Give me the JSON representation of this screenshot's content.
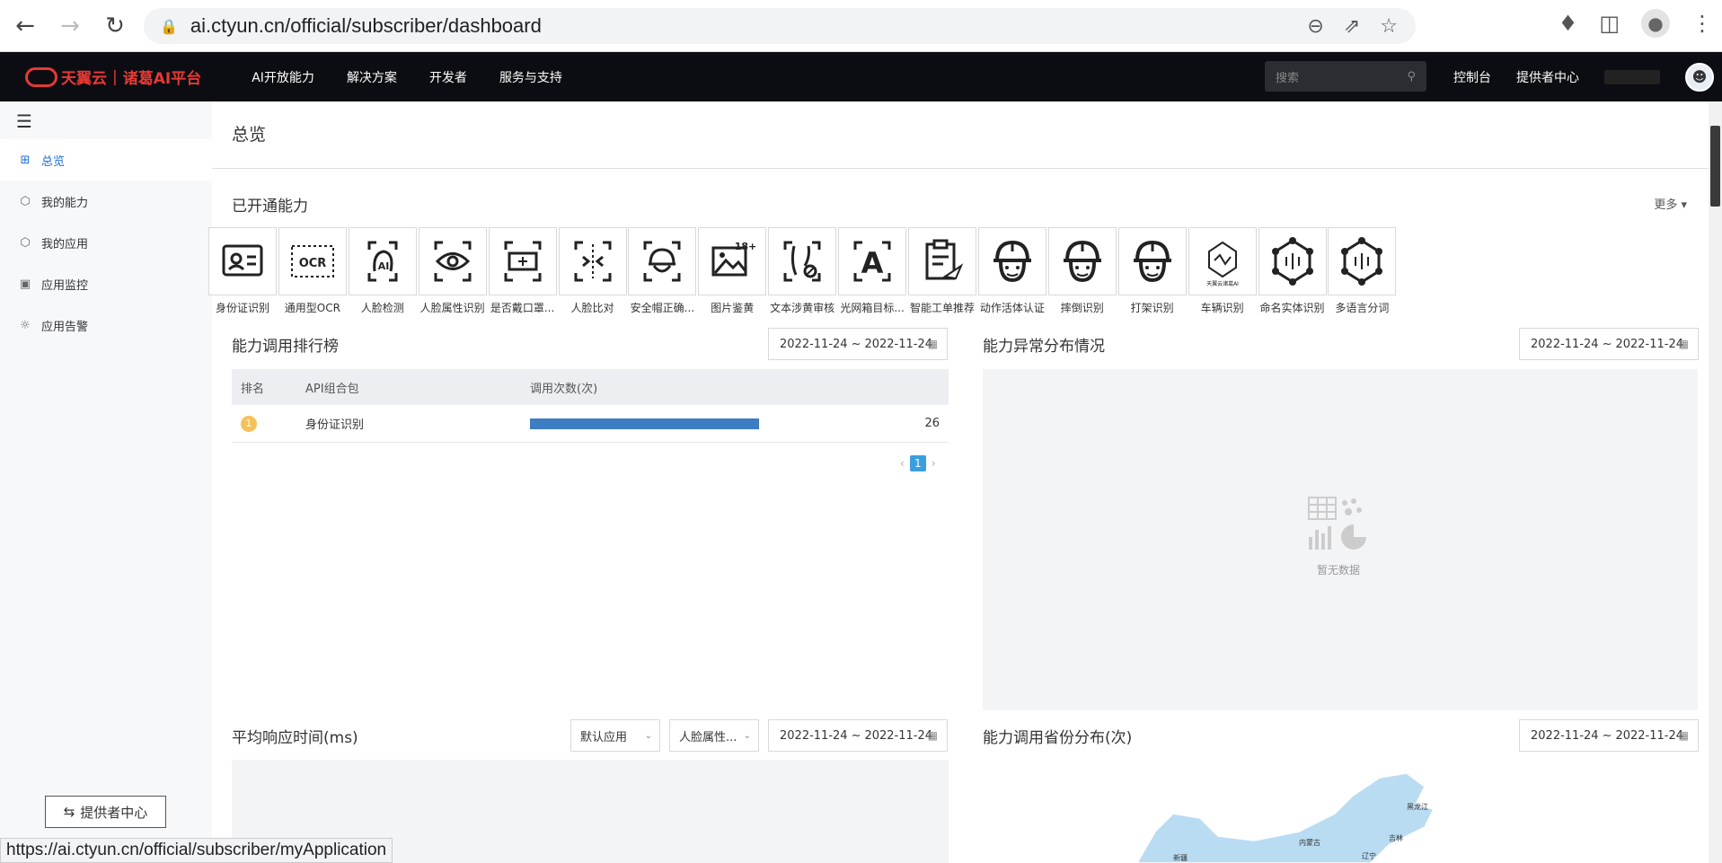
{
  "browser": {
    "url": "ai.ctyun.cn/official/subscriber/dashboard",
    "status_url": "https://ai.ctyun.cn/official/subscriber/myApplication"
  },
  "header": {
    "logo_brand": "天翼云",
    "logo_product": "诸葛AI平台",
    "menu": [
      "AI开放能力",
      "解决方案",
      "开发者",
      "服务与支持"
    ],
    "search_placeholder": "搜索",
    "console": "控制台",
    "provider_center": "提供者中心"
  },
  "sidebar": {
    "items": [
      {
        "label": "总览",
        "icon": "grid-icon",
        "active": true
      },
      {
        "label": "我的能力",
        "icon": "cube-icon",
        "active": false
      },
      {
        "label": "我的应用",
        "icon": "cube-icon",
        "active": false
      },
      {
        "label": "应用监控",
        "icon": "monitor-icon",
        "active": false
      },
      {
        "label": "应用告警",
        "icon": "alarm-icon",
        "active": false
      }
    ],
    "provider_button": "提供者中心"
  },
  "main": {
    "page_title": "总览",
    "capabilities_title": "已开通能力",
    "more": "更多",
    "capabilities": [
      {
        "label": "身份证识别",
        "icon": "id-card-icon"
      },
      {
        "label": "通用型OCR",
        "icon": "ocr-icon"
      },
      {
        "label": "人脸检测",
        "icon": "face-ai-icon"
      },
      {
        "label": "人脸属性识别",
        "icon": "eye-icon"
      },
      {
        "label": "是否戴口罩...",
        "icon": "mask-icon"
      },
      {
        "label": "人脸比对",
        "icon": "face-compare-icon"
      },
      {
        "label": "安全帽正确...",
        "icon": "helmet-icon"
      },
      {
        "label": "图片鉴黄",
        "icon": "image-18-icon"
      },
      {
        "label": "文本涉黄审核",
        "icon": "text-audit-icon"
      },
      {
        "label": "光网箱目标...",
        "icon": "letter-a-icon"
      },
      {
        "label": "智能工单推荐",
        "icon": "clipboard-icon"
      },
      {
        "label": "动作活体认证",
        "icon": "worker-helmet-icon"
      },
      {
        "label": "摔倒识别",
        "icon": "worker-helmet-icon"
      },
      {
        "label": "打架识别",
        "icon": "worker-helmet-icon"
      },
      {
        "label": "车辆识别",
        "icon": "tianyi-ai-icon"
      },
      {
        "label": "命名实体识别",
        "icon": "network-icon"
      },
      {
        "label": "多语言分词",
        "icon": "network-icon"
      }
    ],
    "tianyi_badge": "天翼云诸葛AI",
    "image_badge": "18+",
    "ocr_badge": "OCR",
    "ranking": {
      "title": "能力调用排行榜",
      "date_start": "2022-11-24",
      "date_end": "2022-11-24",
      "date_sep": "~",
      "columns": [
        "排名",
        "API组合包",
        "调用次数(次)"
      ],
      "rows": [
        {
          "rank": "1",
          "name": "身份证识别",
          "count": "26",
          "fraction": 1.0
        }
      ],
      "page": "1"
    },
    "anomaly": {
      "title": "能力异常分布情况",
      "date_start": "2022-11-24",
      "date_end": "2022-11-24",
      "no_data": "暂无数据"
    },
    "response": {
      "title": "平均响应时间(ms)",
      "app_select": "默认应用",
      "cap_select": "人脸属性...",
      "date_start": "2022-11-24",
      "date_end": "2022-11-24"
    },
    "province": {
      "title": "能力调用省份分布(次)",
      "date_start": "2022-11-24",
      "date_end": "2022-11-24",
      "regions": [
        "黑龙江",
        "吉林",
        "辽宁",
        "内蒙古",
        "新疆"
      ]
    }
  }
}
